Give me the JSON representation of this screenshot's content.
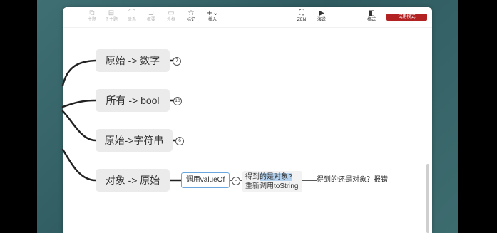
{
  "toolbar": {
    "items": [
      {
        "label": "主题",
        "icon": "topic-icon",
        "glyph": "⧉",
        "active": false
      },
      {
        "label": "子主题",
        "icon": "subtopic-icon",
        "glyph": "⊟",
        "active": false
      },
      {
        "label": "联系",
        "icon": "relationship-icon",
        "glyph": "⌒",
        "active": false
      },
      {
        "label": "概要",
        "icon": "summary-icon",
        "glyph": "⊐",
        "active": false
      },
      {
        "label": "外框",
        "icon": "boundary-icon",
        "glyph": "▭",
        "active": false
      },
      {
        "label": "标记",
        "icon": "star-icon",
        "glyph": "☆",
        "active": true
      },
      {
        "label": "插入",
        "icon": "plus-icon",
        "glyph": "+⌄",
        "active": true
      },
      {
        "label": "ZEN",
        "icon": "zen-icon",
        "glyph": "⛶",
        "active": true
      },
      {
        "label": "演说",
        "icon": "present-icon",
        "glyph": "▶",
        "active": true
      },
      {
        "label": "格式",
        "icon": "format-panel-icon",
        "glyph": "◧",
        "active": true
      }
    ],
    "trial_label": "试用模式"
  },
  "mindmap": {
    "topics": [
      {
        "label": "原始 -> 数字",
        "count": "7"
      },
      {
        "label": "所有 -> bool",
        "count": "10"
      },
      {
        "label": "原始->字符串",
        "count": "6"
      },
      {
        "label": "对象 -> 原始",
        "count": ""
      }
    ],
    "sub1": "调用valueOf",
    "sub2_line1_a": "得到",
    "sub2_line1_b": "的是对象?",
    "sub2_line2": "重新调用toString",
    "sub3": "得到的还是对象？报错",
    "collapse_symbol": "−"
  },
  "colors": {
    "line": "#222222",
    "node": "#ebebeb",
    "trial": "#b22222",
    "selected": "#6aa7de"
  }
}
